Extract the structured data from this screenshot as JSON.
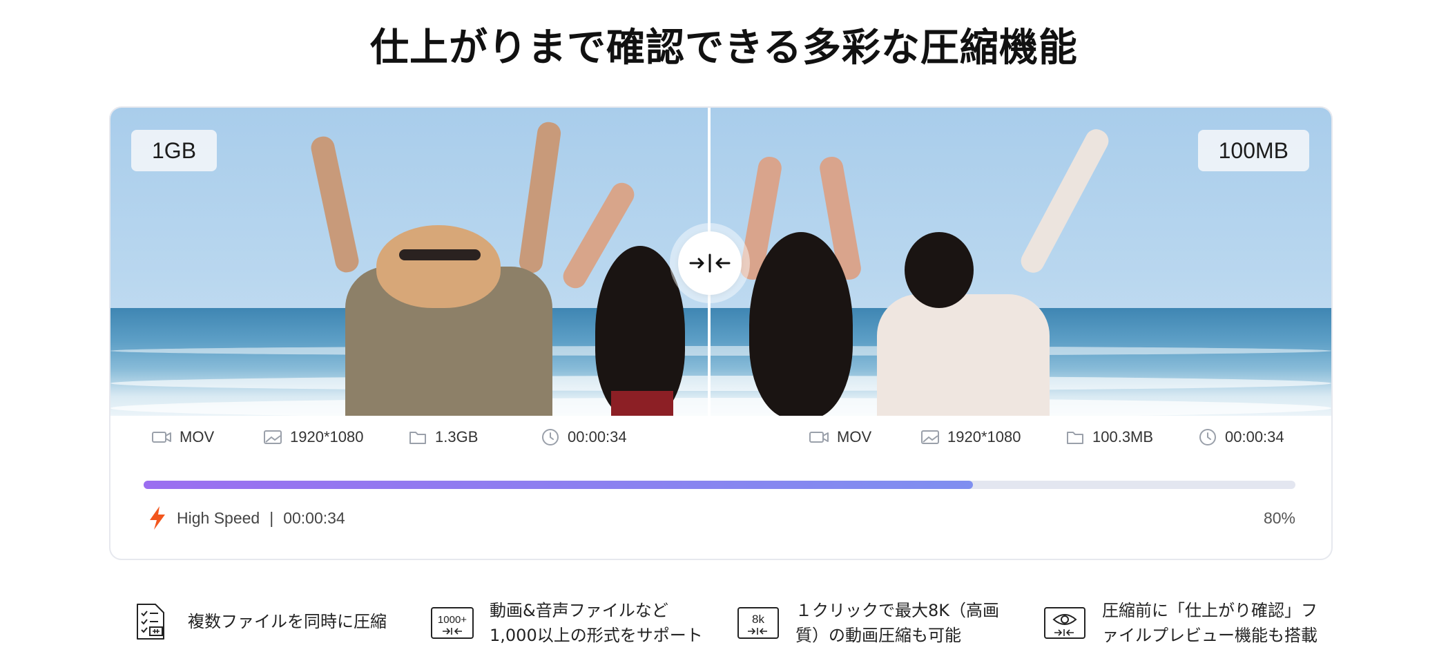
{
  "headline": "仕上がりまで確認できる多彩な圧縮機能",
  "preview": {
    "before_size": "1GB",
    "after_size": "100MB",
    "compare_handle_label": "→|←"
  },
  "before": {
    "format": "MOV",
    "resolution": "1920*1080",
    "size": "1.3GB",
    "duration": "00:00:34"
  },
  "after": {
    "format": "MOV",
    "resolution": "1920*1080",
    "size": "100.3MB",
    "duration": "00:00:34"
  },
  "progress": {
    "fraction": 0.72,
    "mode_label": "High Speed",
    "separator": "|",
    "elapsed": "00:00:34",
    "percent_label": "80%",
    "color_start": "#9b6ef0",
    "color_end": "#7f8ff0",
    "track_color": "#e3e6f0",
    "icon": "lightning-icon",
    "icon_color": "#f2561d"
  },
  "features": [
    {
      "icon": "file-list-icon",
      "line1": "複数ファイルを同時に圧縮",
      "line2": ""
    },
    {
      "icon": "1000-plus-icon",
      "icon_text": "1000+",
      "line1": "動画&音声ファイルなど",
      "line2": "1,000以上の形式をサポート"
    },
    {
      "icon": "8k-icon",
      "icon_text": "8k",
      "line1": "１クリックで最大8K（高画",
      "line2": "質）の動画圧縮も可能"
    },
    {
      "icon": "eye-preview-icon",
      "line1": "圧縮前に「仕上がり確認」フ",
      "line2": "ァイルプレビュー機能も搭載"
    }
  ]
}
